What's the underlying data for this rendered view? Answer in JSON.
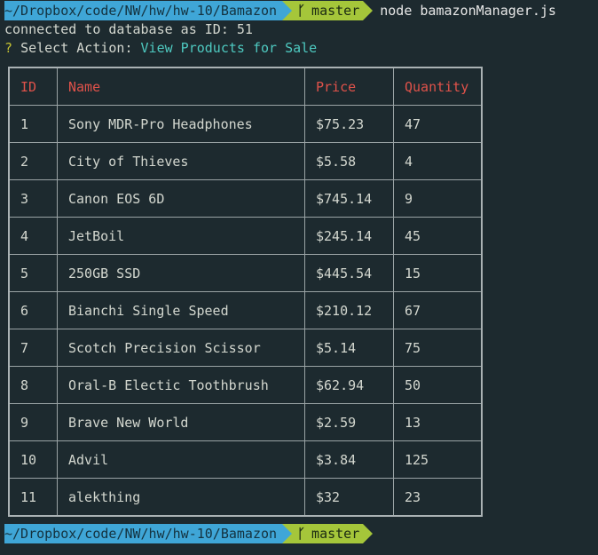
{
  "prompt": {
    "path": "~/Dropbox/code/NW/hw/hw-10/Bamazon",
    "branch": "master",
    "command": "node bamazonManager.js"
  },
  "output": {
    "connected": "connected to database as ID: 51",
    "question_mark": "?",
    "select_label": "Select Action:",
    "select_answer": "View Products for Sale"
  },
  "table": {
    "headers": [
      "ID",
      "Name",
      "Price",
      "Quantity"
    ],
    "rows": [
      [
        "1",
        "Sony MDR-Pro Headphones",
        "$75.23",
        "47"
      ],
      [
        "2",
        "City of Thieves",
        "$5.58",
        "4"
      ],
      [
        "3",
        "Canon EOS 6D",
        "$745.14",
        "9"
      ],
      [
        "4",
        "JetBoil",
        "$245.14",
        "45"
      ],
      [
        "5",
        "250GB SSD",
        "$445.54",
        "15"
      ],
      [
        "6",
        "Bianchi Single Speed",
        "$210.12",
        "67"
      ],
      [
        "7",
        "Scotch Precision Scissor",
        "$5.14",
        "75"
      ],
      [
        "8",
        "Oral-B Electic Toothbrush",
        "$62.94",
        "50"
      ],
      [
        "9",
        "Brave New World",
        "$2.59",
        "13"
      ],
      [
        "10",
        "Advil",
        "$3.84",
        "125"
      ],
      [
        "11",
        "alekthing",
        "$32",
        "23"
      ]
    ]
  },
  "icons": {
    "branch": "git-branch-icon"
  },
  "colors": {
    "background": "#1d2a2f",
    "path_segment": "#3fa6d7",
    "git_segment": "#a5c63a",
    "header_text": "#e0524a",
    "answer_text": "#4ec9c0",
    "question_mark": "#c4c232"
  }
}
